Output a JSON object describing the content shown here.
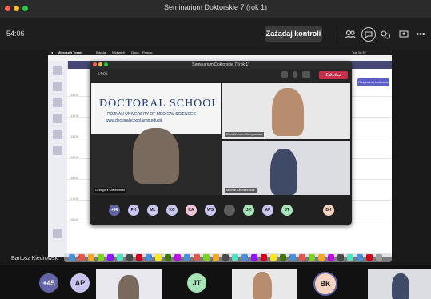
{
  "window": {
    "title": "Seminarium Doktorskie 7 (rok 1)",
    "traffic_lights": [
      "#ff5f57",
      "#febc2e",
      "#28c840"
    ]
  },
  "toolbar": {
    "timer": "54:06",
    "take_control_label": "Zażądaj kontroli",
    "icons": [
      "people-icon",
      "chat-icon",
      "reactions-icon",
      "share-screen-icon",
      "more-icon"
    ]
  },
  "shared_screen": {
    "mac_menu": {
      "app": "Microsoft Teams",
      "items": [
        "Edycja",
        "Wyświetl",
        "Okno",
        "Pomoc"
      ],
      "status": "Tue 16:37"
    },
    "calendar": {
      "times": [
        "12:00",
        "13:00",
        "14:00",
        "15:00",
        "16:00",
        "17:00",
        "18:00"
      ],
      "meet_button": "Rozpocznij spotkanie"
    },
    "meeting_window": {
      "title": "Seminarium Doktorskie 7 (rok 1)",
      "timer": "54:05",
      "leave_label": "Zakończ",
      "banner": {
        "title": "DOCTORAL SCHOOL",
        "subtitle": "POZNAN UNIVERSITY OF MEDICAL SCIENCES",
        "url": "www.doctoralschool.ump.edu.pl"
      },
      "participants": [
        {
          "name": "Grzegorz Kiedrowski"
        },
        {
          "name": "Ewa Wender-Ożegowska"
        },
        {
          "name": "Michał Kaźmierczak"
        }
      ],
      "avatars": [
        {
          "label": "+36",
          "color": "#6264a7"
        },
        {
          "label": "PK",
          "color": "#c8c6f0"
        },
        {
          "label": "ML",
          "color": "#c8c6f0"
        },
        {
          "label": "KC",
          "color": "#c8c6f0"
        },
        {
          "label": "KA",
          "color": "#f3c4d8"
        },
        {
          "label": "WS",
          "color": "#c8c6f0"
        },
        {
          "label": "",
          "color": "#5d5d5d"
        },
        {
          "label": "JK",
          "color": "#a6e3b6"
        },
        {
          "label": "AP",
          "color": "#c8c6f0"
        },
        {
          "label": "JT",
          "color": "#a6e3b6"
        },
        {
          "label": "BK",
          "color": "#f6d2c0"
        }
      ]
    }
  },
  "presenter_caption": "Bartosz Kiedrowski",
  "bottom_strip": {
    "avatars": [
      {
        "label": "+45",
        "color": "#6264a7",
        "text": "#ffffff"
      },
      {
        "label": "AP",
        "color": "#c8c6f0",
        "text": "#222222"
      },
      {
        "label": "JT",
        "color": "#a6e3b6",
        "text": "#222222"
      },
      {
        "label": "BK",
        "color": "#f6d2c0",
        "text": "#222222"
      }
    ]
  }
}
